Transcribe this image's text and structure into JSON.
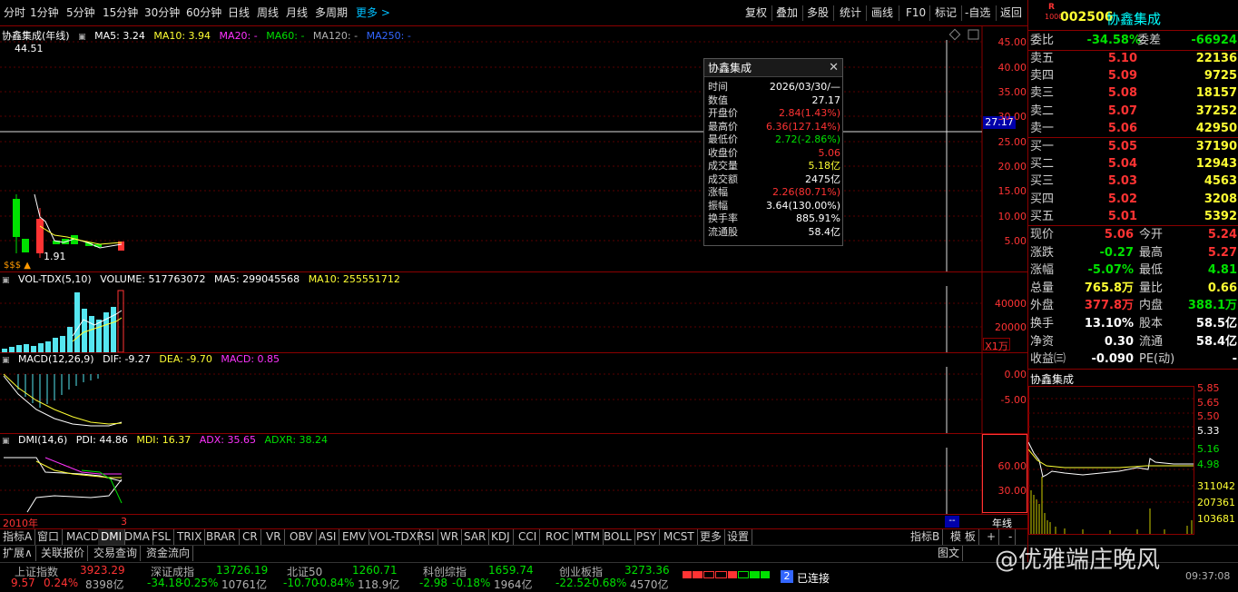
{
  "toolbar": {
    "items": [
      "分时",
      "1分钟",
      "5分钟",
      "15分钟",
      "30分钟",
      "60分钟",
      "日线",
      "周线",
      "月线",
      "多周期",
      "更多 >"
    ],
    "right_items": [
      "复权",
      "叠加",
      "多股",
      "统计",
      "画线",
      "F10",
      "标记",
      "-自选",
      "返回"
    ]
  },
  "main_chart": {
    "legend": {
      "name": "协鑫集成(年线)",
      "ma5": "MA5: 3.24",
      "ma10": "MA10: 3.94",
      "ma20": "MA20: -",
      "ma60": "MA60: -",
      "ma120": "MA120: -",
      "ma250": "MA250: -"
    },
    "high_label": "44.51",
    "low_label": "1.91",
    "cross_value": "27.17",
    "yticks": [
      "45.00",
      "40.00",
      "35.00",
      "30.00",
      "25.00",
      "20.00",
      "15.00",
      "10.00",
      "5.00"
    ],
    "marks": "$$$ ▲"
  },
  "vol_chart": {
    "legend": {
      "name": "VOL-TDX(5,10)",
      "volume": "VOLUME: 517763072",
      "ma5": "MA5: 299045568",
      "ma10": "MA10: 255551712"
    },
    "yticks": [
      "40000",
      "20000"
    ],
    "unit": "X1万"
  },
  "macd_chart": {
    "legend": {
      "name": "MACD(12,26,9)",
      "dif": "DIF: -9.27",
      "dea": "DEA: -9.70",
      "macd": "MACD: 0.85"
    },
    "yticks": [
      "0.00",
      "-5.00"
    ]
  },
  "dmi_chart": {
    "legend": {
      "name": "DMI(14,6)",
      "pdi": "PDI: 44.86",
      "mdi": "MDI: 16.37",
      "adx": "ADX: 35.65",
      "adxr": "ADXR: 38.24"
    },
    "yticks": [
      "60.00",
      "30.00"
    ]
  },
  "bottom": {
    "year_label": "2010年",
    "three": "3",
    "period": "年线",
    "tabs": [
      "指标A",
      "窗口",
      "MACD",
      "DMI",
      "DMA",
      "FSL",
      "TRIX",
      "BRAR",
      "CR",
      "VR",
      "OBV",
      "ASI",
      "EMV",
      "VOL-TDX",
      "RSI",
      "WR",
      "SAR",
      "KDJ",
      "CCI",
      "ROC",
      "MTM",
      "BOLL",
      "PSY",
      "MCST",
      "更多",
      "设置"
    ],
    "right_tabs": [
      "指标B",
      "模 板",
      "+",
      "-"
    ],
    "tabs2": [
      "扩展∧",
      "关联报价",
      "交易查询",
      "资金流向"
    ],
    "tabs2_right": [
      "图文"
    ]
  },
  "tooltip": {
    "title": "协鑫集成",
    "rows": [
      {
        "k": "时间",
        "v": "2026/03/30/—",
        "c": "white"
      },
      {
        "k": "数值",
        "v": "27.17",
        "c": "white"
      },
      {
        "k": "开盘价",
        "v": "2.84(1.43%)",
        "c": "red"
      },
      {
        "k": "最高价",
        "v": "6.36(127.14%)",
        "c": "red"
      },
      {
        "k": "最低价",
        "v": "2.72(-2.86%)",
        "c": "green"
      },
      {
        "k": "收盘价",
        "v": "5.06",
        "c": "red"
      },
      {
        "k": "成交量",
        "v": "5.18亿",
        "c": "yellow"
      },
      {
        "k": "成交额",
        "v": "2475亿",
        "c": "white"
      },
      {
        "k": "涨幅",
        "v": "2.26(80.71%)",
        "c": "red"
      },
      {
        "k": "振幅",
        "v": "3.64(130.00%)",
        "c": "white"
      },
      {
        "k": "换手率",
        "v": "885.91%",
        "c": "white"
      },
      {
        "k": "流通股",
        "v": "58.4亿",
        "c": "white"
      }
    ]
  },
  "quote": {
    "badge": "R",
    "badge2": "1000",
    "code": "002506",
    "name": "协鑫集成",
    "weibi_label": "委比",
    "weibi": "-34.58%",
    "weicha_label": "委差",
    "weicha": "-66924",
    "sells": [
      {
        "label": "卖五",
        "price": "5.10",
        "vol": "22136"
      },
      {
        "label": "卖四",
        "price": "5.09",
        "vol": "9725"
      },
      {
        "label": "卖三",
        "price": "5.08",
        "vol": "18157"
      },
      {
        "label": "卖二",
        "price": "5.07",
        "vol": "37252"
      },
      {
        "label": "卖一",
        "price": "5.06",
        "vol": "42950"
      }
    ],
    "buys": [
      {
        "label": "买一",
        "price": "5.05",
        "vol": "37190"
      },
      {
        "label": "买二",
        "price": "5.04",
        "vol": "12943"
      },
      {
        "label": "买三",
        "price": "5.03",
        "vol": "4563"
      },
      {
        "label": "买四",
        "price": "5.02",
        "vol": "3208"
      },
      {
        "label": "买五",
        "price": "5.01",
        "vol": "5392"
      }
    ],
    "stats": [
      {
        "k1": "现价",
        "v1": "5.06",
        "c1": "red",
        "k2": "今开",
        "v2": "5.24",
        "c2": "red"
      },
      {
        "k1": "涨跌",
        "v1": "-0.27",
        "c1": "green",
        "k2": "最高",
        "v2": "5.27",
        "c2": "red"
      },
      {
        "k1": "涨幅",
        "v1": "-5.07%",
        "c1": "green",
        "k2": "最低",
        "v2": "4.81",
        "c2": "green"
      },
      {
        "k1": "总量",
        "v1": "765.8万",
        "c1": "yellow",
        "k2": "量比",
        "v2": "0.66",
        "c2": "yellow"
      },
      {
        "k1": "外盘",
        "v1": "377.8万",
        "c1": "red",
        "k2": "内盘",
        "v2": "388.1万",
        "c2": "green"
      },
      {
        "k1": "换手",
        "v1": "13.10%",
        "c1": "white",
        "k2": "股本",
        "v2": "58.5亿",
        "c2": "white"
      },
      {
        "k1": "净资",
        "v1": "0.30",
        "c1": "white",
        "k2": "流通",
        "v2": "58.4亿",
        "c2": "white"
      },
      {
        "k1": "收益㈢",
        "v1": "-0.090",
        "c1": "white",
        "k2": "PE(动)",
        "v2": "-",
        "c2": "white"
      }
    ],
    "mini_title": "协鑫集成",
    "mini_yticks": [
      "5.85",
      "5.65",
      "5.50",
      "5.33",
      "5.16",
      "4.98"
    ],
    "mini_vticks": [
      "311042",
      "207361",
      "103681"
    ]
  },
  "status": {
    "indices": [
      {
        "name": "上证指数",
        "value": "3923.29",
        "chg": "9.57",
        "pct": "0.24%",
        "amt": "8398亿",
        "c": "red"
      },
      {
        "name": "深证成指",
        "value": "13726.19",
        "chg": "-34.18",
        "pct": "-0.25%",
        "amt": "10761亿",
        "c": "green"
      },
      {
        "name": "北证50",
        "value": "1260.71",
        "chg": "-10.70",
        "pct": "-0.84%",
        "amt": "118.9亿",
        "c": "green"
      },
      {
        "name": "科创综指",
        "value": "1659.74",
        "chg": "-2.98",
        "pct": "-0.18%",
        "amt": "1964亿",
        "c": "green"
      },
      {
        "name": "创业板指",
        "value": "3273.36",
        "chg": "-22.52",
        "pct": "-0.68%",
        "amt": "4570亿",
        "c": "green"
      }
    ],
    "conn_num": "2",
    "conn": "已连接",
    "time": "09:37:08",
    "watermark": "@优雅端庄晚风"
  },
  "colors": {
    "panel_border": "#8b0000",
    "up": "#ff3333",
    "down": "#00e000",
    "bg": "#000000"
  }
}
